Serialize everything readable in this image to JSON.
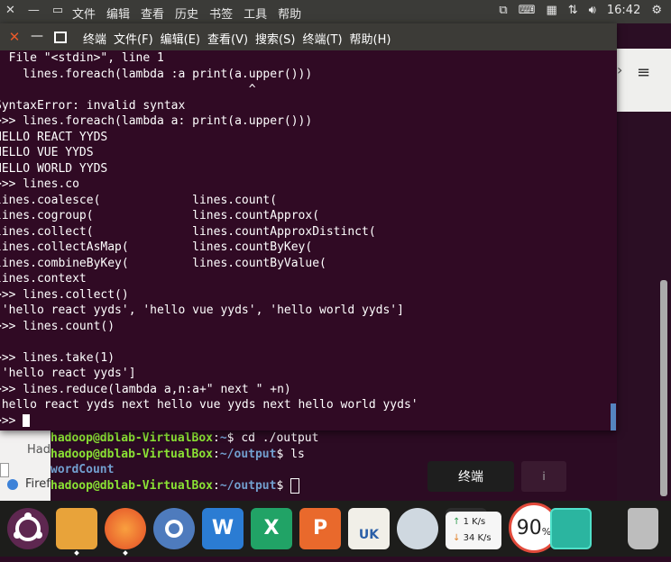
{
  "system_bar": {
    "menus": [
      "文件",
      "编辑",
      "查看",
      "历史",
      "书签",
      "工具",
      "帮助"
    ],
    "clock": "16:42",
    "tray_icons": [
      "bluetooth-icon",
      "input-method-icon",
      "keyboard-icon",
      "network-icon",
      "volume-icon",
      "power-icon"
    ]
  },
  "terminal": {
    "title_items": [
      "终端",
      "文件(F)",
      "编辑(E)",
      "查看(V)",
      "搜索(S)",
      "终端(T)",
      "帮助(H)"
    ],
    "lines": [
      "  File \"<stdin>\", line 1",
      "    lines.foreach(lambda :a print(a.upper()))",
      "                                    ^",
      "SyntaxError: invalid syntax",
      ">>> lines.foreach(lambda a: print(a.upper()))",
      "HELLO REACT YYDS",
      "HELLO VUE YYDS",
      "HELLO WORLD YYDS",
      ">>> lines.co",
      "lines.coalesce(             lines.count(",
      "lines.cogroup(              lines.countApprox(",
      "lines.collect(              lines.countApproxDistinct(",
      "lines.collectAsMap(         lines.countByKey(",
      "lines.combineByKey(         lines.countByValue(",
      "lines.context",
      ">>> lines.collect()",
      "['hello react yyds', 'hello vue yyds', 'hello world yyds']",
      ">>> lines.count()",
      "",
      ">>> lines.take(1)",
      "['hello react yyds']",
      ">>> lines.reduce(lambda a,n:a+\" next \" +n)",
      "'hello react yyds next hello vue yyds next hello world yyds'",
      ">>> "
    ]
  },
  "background_terminal": {
    "lines": [
      {
        "user": "hadoop@dblab-VirtualBox",
        "path": "~",
        "cmd": "$ cd ./output"
      },
      {
        "user": "hadoop@dblab-VirtualBox",
        "path": "~/output",
        "cmd": "$ ls"
      },
      {
        "output": "wordCount"
      },
      {
        "user": "hadoop@dblab-VirtualBox",
        "path": "~/output",
        "cmd": "$ "
      }
    ]
  },
  "left_sliver": {
    "tab_text": "Hado",
    "browser_text": "Firef"
  },
  "tooltip": "终端",
  "ghost_label": "i",
  "dock": {
    "items": [
      "ubuntu-logo-icon",
      "files-icon",
      "firefox-icon",
      "chromium-icon",
      "word-icon",
      "excel-icon",
      "powerpoint-icon",
      "ubuntu-software-icon",
      "vpn-icon",
      "terminal-icon",
      "update-icon",
      "trash-icon"
    ],
    "net_up": "1  K/s",
    "net_down": "34  K/s",
    "gauge_value": "90",
    "gauge_unit": "%"
  }
}
